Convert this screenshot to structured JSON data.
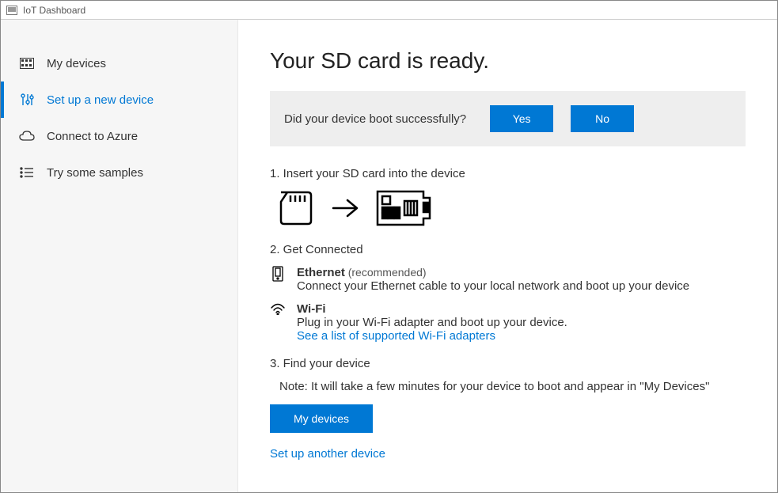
{
  "window": {
    "title": "IoT Dashboard"
  },
  "sidebar": {
    "items": [
      {
        "label": "My devices"
      },
      {
        "label": "Set up a new device"
      },
      {
        "label": "Connect to Azure"
      },
      {
        "label": "Try some samples"
      }
    ],
    "active_index": 1
  },
  "main": {
    "title": "Your SD card is ready.",
    "prompt": {
      "question": "Did your device boot successfully?",
      "yes": "Yes",
      "no": "No"
    },
    "step1": "1. Insert your SD card into the device",
    "step2": "2. Get Connected",
    "ethernet": {
      "title": "Ethernet",
      "recommended": " (recommended)",
      "desc": "Connect your Ethernet cable to your local network and boot up your device"
    },
    "wifi": {
      "title": "Wi-Fi",
      "desc": "Plug in your Wi-Fi adapter and boot up your device.",
      "link": "See a list of supported Wi-Fi adapters"
    },
    "step3": "3. Find your device",
    "note": "Note: It will take a few minutes for your device to boot and appear in \"My Devices\"",
    "my_devices_button": "My devices",
    "setup_another": "Set up another device"
  },
  "colors": {
    "accent": "#0078d4",
    "panel_bg": "#eeeeee",
    "sidebar_bg": "#f6f6f6"
  }
}
